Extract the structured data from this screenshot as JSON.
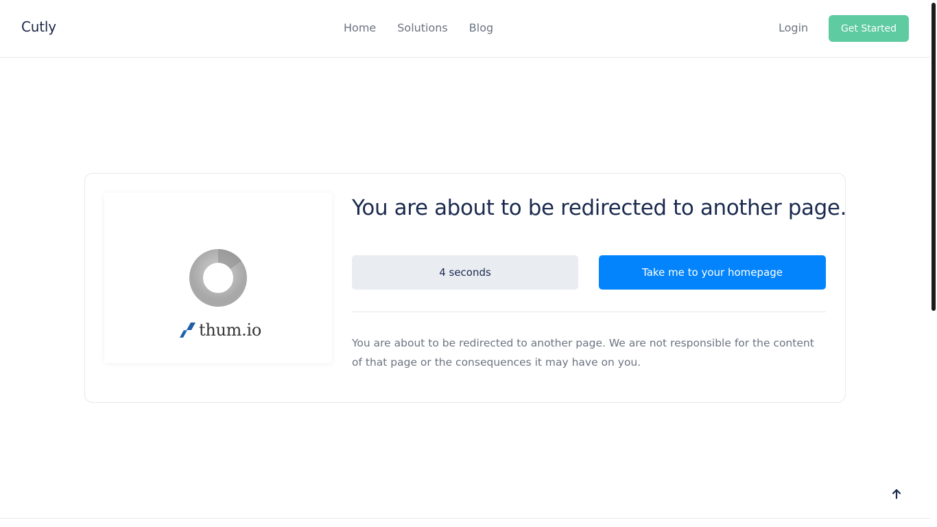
{
  "header": {
    "brand": "Cutly",
    "nav": [
      "Home",
      "Solutions",
      "Blog"
    ],
    "login_label": "Login",
    "cta_label": "Get Started"
  },
  "redirect": {
    "title": "You are about to be redirected to another page.",
    "countdown_label": "4 seconds",
    "home_button_label": "Take me to your homepage",
    "notice": "You are about to be redirected to another page. We are not responsible for the content of that page or the consequences it may have on you."
  },
  "thumbnail": {
    "logo_text": "thum.io",
    "icon": "loading-spinner-icon"
  },
  "icons": {
    "back_to_top": "arrow-up-icon"
  },
  "colors": {
    "primary_button": "#0384fc",
    "cta_button": "#5ecba1",
    "heading": "#1b2a4e",
    "muted_text": "#6b7280"
  }
}
